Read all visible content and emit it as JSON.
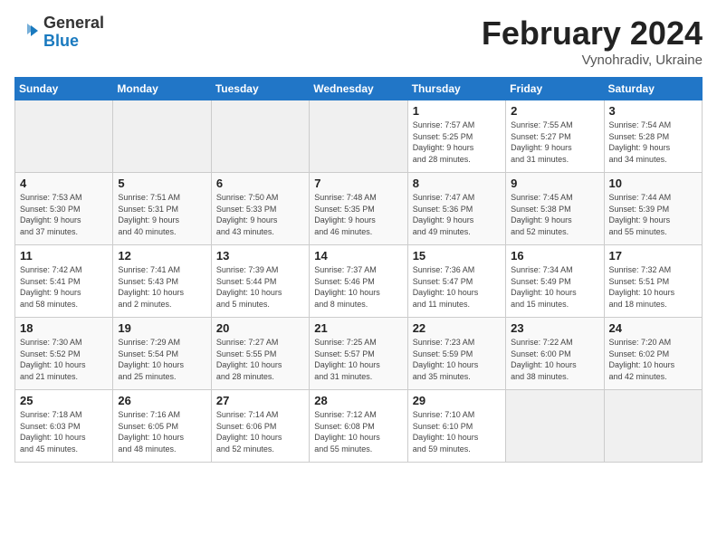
{
  "header": {
    "logo_line1": "General",
    "logo_line2": "Blue",
    "month_title": "February 2024",
    "location": "Vynohradiv, Ukraine"
  },
  "days_of_week": [
    "Sunday",
    "Monday",
    "Tuesday",
    "Wednesday",
    "Thursday",
    "Friday",
    "Saturday"
  ],
  "weeks": [
    [
      {
        "num": "",
        "detail": ""
      },
      {
        "num": "",
        "detail": ""
      },
      {
        "num": "",
        "detail": ""
      },
      {
        "num": "",
        "detail": ""
      },
      {
        "num": "1",
        "detail": "Sunrise: 7:57 AM\nSunset: 5:25 PM\nDaylight: 9 hours\nand 28 minutes."
      },
      {
        "num": "2",
        "detail": "Sunrise: 7:55 AM\nSunset: 5:27 PM\nDaylight: 9 hours\nand 31 minutes."
      },
      {
        "num": "3",
        "detail": "Sunrise: 7:54 AM\nSunset: 5:28 PM\nDaylight: 9 hours\nand 34 minutes."
      }
    ],
    [
      {
        "num": "4",
        "detail": "Sunrise: 7:53 AM\nSunset: 5:30 PM\nDaylight: 9 hours\nand 37 minutes."
      },
      {
        "num": "5",
        "detail": "Sunrise: 7:51 AM\nSunset: 5:31 PM\nDaylight: 9 hours\nand 40 minutes."
      },
      {
        "num": "6",
        "detail": "Sunrise: 7:50 AM\nSunset: 5:33 PM\nDaylight: 9 hours\nand 43 minutes."
      },
      {
        "num": "7",
        "detail": "Sunrise: 7:48 AM\nSunset: 5:35 PM\nDaylight: 9 hours\nand 46 minutes."
      },
      {
        "num": "8",
        "detail": "Sunrise: 7:47 AM\nSunset: 5:36 PM\nDaylight: 9 hours\nand 49 minutes."
      },
      {
        "num": "9",
        "detail": "Sunrise: 7:45 AM\nSunset: 5:38 PM\nDaylight: 9 hours\nand 52 minutes."
      },
      {
        "num": "10",
        "detail": "Sunrise: 7:44 AM\nSunset: 5:39 PM\nDaylight: 9 hours\nand 55 minutes."
      }
    ],
    [
      {
        "num": "11",
        "detail": "Sunrise: 7:42 AM\nSunset: 5:41 PM\nDaylight: 9 hours\nand 58 minutes."
      },
      {
        "num": "12",
        "detail": "Sunrise: 7:41 AM\nSunset: 5:43 PM\nDaylight: 10 hours\nand 2 minutes."
      },
      {
        "num": "13",
        "detail": "Sunrise: 7:39 AM\nSunset: 5:44 PM\nDaylight: 10 hours\nand 5 minutes."
      },
      {
        "num": "14",
        "detail": "Sunrise: 7:37 AM\nSunset: 5:46 PM\nDaylight: 10 hours\nand 8 minutes."
      },
      {
        "num": "15",
        "detail": "Sunrise: 7:36 AM\nSunset: 5:47 PM\nDaylight: 10 hours\nand 11 minutes."
      },
      {
        "num": "16",
        "detail": "Sunrise: 7:34 AM\nSunset: 5:49 PM\nDaylight: 10 hours\nand 15 minutes."
      },
      {
        "num": "17",
        "detail": "Sunrise: 7:32 AM\nSunset: 5:51 PM\nDaylight: 10 hours\nand 18 minutes."
      }
    ],
    [
      {
        "num": "18",
        "detail": "Sunrise: 7:30 AM\nSunset: 5:52 PM\nDaylight: 10 hours\nand 21 minutes."
      },
      {
        "num": "19",
        "detail": "Sunrise: 7:29 AM\nSunset: 5:54 PM\nDaylight: 10 hours\nand 25 minutes."
      },
      {
        "num": "20",
        "detail": "Sunrise: 7:27 AM\nSunset: 5:55 PM\nDaylight: 10 hours\nand 28 minutes."
      },
      {
        "num": "21",
        "detail": "Sunrise: 7:25 AM\nSunset: 5:57 PM\nDaylight: 10 hours\nand 31 minutes."
      },
      {
        "num": "22",
        "detail": "Sunrise: 7:23 AM\nSunset: 5:59 PM\nDaylight: 10 hours\nand 35 minutes."
      },
      {
        "num": "23",
        "detail": "Sunrise: 7:22 AM\nSunset: 6:00 PM\nDaylight: 10 hours\nand 38 minutes."
      },
      {
        "num": "24",
        "detail": "Sunrise: 7:20 AM\nSunset: 6:02 PM\nDaylight: 10 hours\nand 42 minutes."
      }
    ],
    [
      {
        "num": "25",
        "detail": "Sunrise: 7:18 AM\nSunset: 6:03 PM\nDaylight: 10 hours\nand 45 minutes."
      },
      {
        "num": "26",
        "detail": "Sunrise: 7:16 AM\nSunset: 6:05 PM\nDaylight: 10 hours\nand 48 minutes."
      },
      {
        "num": "27",
        "detail": "Sunrise: 7:14 AM\nSunset: 6:06 PM\nDaylight: 10 hours\nand 52 minutes."
      },
      {
        "num": "28",
        "detail": "Sunrise: 7:12 AM\nSunset: 6:08 PM\nDaylight: 10 hours\nand 55 minutes."
      },
      {
        "num": "29",
        "detail": "Sunrise: 7:10 AM\nSunset: 6:10 PM\nDaylight: 10 hours\nand 59 minutes."
      },
      {
        "num": "",
        "detail": ""
      },
      {
        "num": "",
        "detail": ""
      }
    ]
  ]
}
